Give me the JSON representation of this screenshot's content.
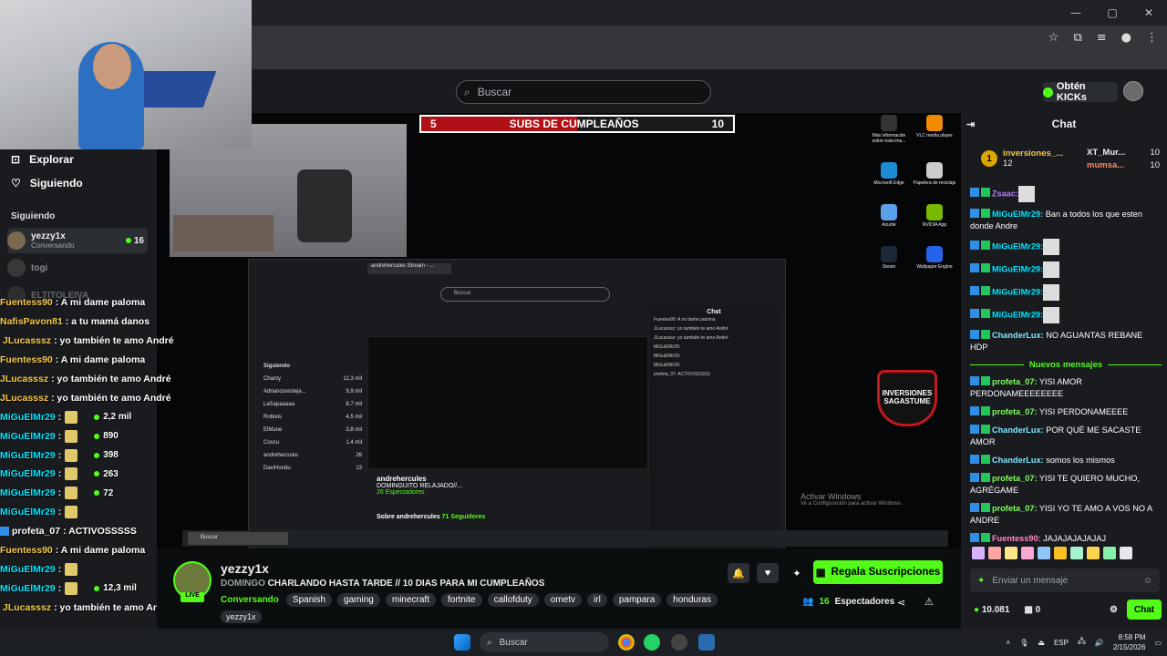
{
  "browser": {
    "window_controls": [
      "—",
      "▢",
      "✕"
    ]
  },
  "header": {
    "search_placeholder": "Buscar",
    "kicks_label": "Obtén KICKs"
  },
  "sidebar": {
    "nav": [
      {
        "label": "Explorar",
        "icon": "compass-icon"
      },
      {
        "label": "Siguiendo",
        "icon": "heart-icon"
      }
    ],
    "section_title": "Siguiendo",
    "channels": [
      {
        "name": "yezzy1x",
        "category": "Conversando",
        "viewers": "16"
      },
      {
        "name": "togi",
        "category": "",
        "viewers": ""
      },
      {
        "name": "ELTITOLEIVA",
        "category": "",
        "viewers": ""
      }
    ]
  },
  "goal": {
    "start": "5",
    "title": "SUBS DE CUMPLEAÑOS",
    "end": "10",
    "progress": 0.5
  },
  "nested": {
    "tab": "andrehercules Stream - ...",
    "search": "Buscar",
    "chat_title": "Chat",
    "chat_lines": [
      "Fuentes90: A mi dame paloma",
      "JLucasssz: yo también te amo André",
      "JLucasssz: yo también te amo André",
      "MiGuElMr29:",
      "MiGuElMr29:",
      "MiGuElMr29:",
      "profeta_07: ACTIVOSSSSS"
    ],
    "sidebar_title": "Siguiendo",
    "sidebar": [
      {
        "name": "Chanty",
        "count": "11,3 mil"
      },
      {
        "name": "Adrianozendeja...",
        "count": "9,9 mil"
      },
      {
        "name": "LaSapaaaaa",
        "count": "8,7 mil"
      },
      {
        "name": "Robleis",
        "count": "4,5 mil"
      },
      {
        "name": "ElMune",
        "count": "3,8 mil"
      },
      {
        "name": "Coscu",
        "count": "1,4 mil"
      },
      {
        "name": "andrehercules",
        "count": "26"
      },
      {
        "name": "DaviHondu",
        "count": "13"
      }
    ],
    "streamer": "andrehercules",
    "title": "DOMINGUITO RELAJADO//...",
    "viewers": "26 Espectadores",
    "about": "Sobre andrehercules",
    "followers": "71 Seguidores"
  },
  "desktop_icons": [
    {
      "label": "Más información sobre esta ima...",
      "color": "#333"
    },
    {
      "label": "VLC media player",
      "color": "#f08a00"
    },
    {
      "label": "Microsoft Edge",
      "color": "#1b8bd6"
    },
    {
      "label": "Papelera de reciclaje",
      "color": "#ccc"
    },
    {
      "label": "Azurite",
      "color": "#5aa0e8"
    },
    {
      "label": "NVIDIA App",
      "color": "#76b900"
    },
    {
      "label": "Steam",
      "color": "#1b2838"
    },
    {
      "label": "Wallpaper Engine",
      "color": "#2563eb"
    }
  ],
  "badge_logo": "INVERSIONES SAGASTUME",
  "activate": {
    "title": "Activar Windows",
    "sub": "Ve a Configuración para activar Windows."
  },
  "overlay_chat": [
    {
      "user": "Fuentess90",
      "color": "#f7c948",
      "msg": ": A mi dame paloma"
    },
    {
      "user": "NafisPavon81",
      "color": "#f7c948",
      "msg": ": a tu mamá danos"
    },
    {
      "user": "JLucasssz",
      "color": "#f7c948",
      "msg": ": yo también te amo André",
      "badge": true
    },
    {
      "user": "Fuentess90",
      "color": "#f7c948",
      "msg": ": A mi dame paloma"
    },
    {
      "user": "JLucasssz",
      "color": "#f7c948",
      "msg": ": yo también te amo André"
    },
    {
      "user": "JLucasssz",
      "color": "#f7c948",
      "msg": ": yo también te amo André"
    },
    {
      "user": "MiGuElMr29",
      "color": "#00e5ff",
      "msg": " :",
      "emote": true,
      "num": "2,2 mil"
    },
    {
      "user": "MiGuElMr29",
      "color": "#00e5ff",
      "msg": " :",
      "emote": true,
      "num": "890"
    },
    {
      "user": "MiGuElMr29",
      "color": "#00e5ff",
      "msg": " :",
      "emote": true,
      "num": "398"
    },
    {
      "user": "MiGuElMr29",
      "color": "#00e5ff",
      "msg": " :",
      "emote": true,
      "num": "263"
    },
    {
      "user": "MiGuElMr29",
      "color": "#00e5ff",
      "msg": " :",
      "emote": true,
      "num": "72"
    },
    {
      "user": "MiGuElMr29",
      "color": "#00e5ff",
      "msg": " :",
      "emote": true,
      "num": ""
    },
    {
      "user": "profeta_07",
      "color": "#fff",
      "msg": " : ACTIVOSSSSS",
      "badge": true
    },
    {
      "user": "Fuentess90",
      "color": "#f7c948",
      "msg": ": A mi dame paloma"
    },
    {
      "user": "MiGuElMr29",
      "color": "#00e5ff",
      "msg": " :",
      "emote": true,
      "num": ""
    },
    {
      "user": "MiGuElMr29",
      "color": "#00e5ff",
      "msg": " :",
      "emote": true,
      "num": "12,3 mil"
    },
    {
      "user": "JLucasssz",
      "color": "#f7c948",
      "msg": ": yo también te amo André",
      "badge": true
    }
  ],
  "stream": {
    "channel": "yezzy1x",
    "live": "LIVE",
    "title_prefix": "DOMINGO",
    "title": "CHARLANDO HASTA TARDE // 10 DIAS PARA MI CUMPLEAÑOS",
    "category": "Conversando",
    "tags": [
      "Spanish",
      "gaming",
      "minecraft",
      "fortnite",
      "callofduty",
      "ometv",
      "irl",
      "pampara",
      "honduras"
    ],
    "handle": "yezzy1x",
    "gift_label": "Regala Suscripciones",
    "viewers": "16",
    "viewers_label": "Espectadores"
  },
  "chat": {
    "title": "Chat",
    "leaderboard": {
      "rank": "1",
      "user": "inversiones_...",
      "count": "12",
      "second_user": "XT_Mur...",
      "second_count": "10",
      "third_user": "mumsa...",
      "third_count": "10"
    },
    "messages": [
      {
        "user": "Zsaac:",
        "color": "#b57bff",
        "text": "",
        "emote": true
      },
      {
        "user": "MiGuElMr29:",
        "color": "#00e5ff",
        "text": " Ban a todos los que esten donde Andre"
      },
      {
        "user": "MiGuElMr29:",
        "color": "#00e5ff",
        "text": "",
        "emote": true
      },
      {
        "user": "MiGuElMr29:",
        "color": "#00e5ff",
        "text": "",
        "emote": true
      },
      {
        "user": "MiGuElMr29:",
        "color": "#00e5ff",
        "text": "",
        "emote": true
      },
      {
        "user": "MiGuElMr29:",
        "color": "#00e5ff",
        "text": "",
        "emote": true
      },
      {
        "user": "ChanderLux:",
        "color": "#7be8ff",
        "text": " NO AGUANTAS REBANE HDP"
      }
    ],
    "new_messages_label": "Nuevos mensajes",
    "new_messages": [
      {
        "user": "profeta_07:",
        "color": "#7bff5a",
        "text": " YISI AMOR PERDONAMEEEEEEEE"
      },
      {
        "user": "profeta_07:",
        "color": "#7bff5a",
        "text": " YISI PERDONAMEEEE"
      },
      {
        "user": "ChanderLux:",
        "color": "#7be8ff",
        "text": " POR QUÉ ME SACASTE AMOR"
      },
      {
        "user": "ChanderLux:",
        "color": "#7be8ff",
        "text": " somos los mismos"
      },
      {
        "user": "profeta_07:",
        "color": "#7bff5a",
        "text": " YISI TE QUIERO MUCHO, AGRÉGAME"
      },
      {
        "user": "profeta_07:",
        "color": "#7bff5a",
        "text": " YISI YO TE AMO A VOS NO A ANDRE"
      },
      {
        "user": "Fuentess90:",
        "color": "#ff8ac2",
        "text": " JAJAJAJAJAJAJ"
      }
    ],
    "input_placeholder": "Enviar un mensaje",
    "kicks": "10.081",
    "subs": "0",
    "send_label": "Chat"
  },
  "taskbar": {
    "search": "Buscar",
    "lang": "ESP",
    "time": "8:58 PM",
    "date": "2/15/2026"
  }
}
